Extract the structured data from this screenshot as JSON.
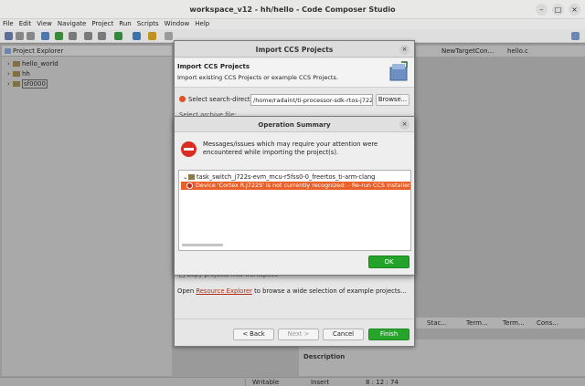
{
  "window": {
    "title": "workspace_v12 - hh/hello - Code Composer Studio"
  },
  "menu": [
    "File",
    "Edit",
    "View",
    "Navigate",
    "Project",
    "Run",
    "Scripts",
    "Window",
    "Help"
  ],
  "project_explorer": {
    "tab_label": "Project Explorer",
    "items": [
      {
        "label": "hello_world"
      },
      {
        "label": "hh"
      },
      {
        "label": "sf0000"
      }
    ]
  },
  "editor_tabs": [
    "NewTargetCon...",
    "hello.c"
  ],
  "lower_right_tabs": [
    "Stac...",
    "Term...",
    "Term...",
    "Cons..."
  ],
  "description_label": "Description",
  "status_bar": {
    "mode": "Writable",
    "insert": "Insert",
    "position": "8 : 12 : 74"
  },
  "import_dialog": {
    "title": "Import CCS Projects",
    "heading": "Import CCS Projects",
    "subheading": "Import existing CCS Projects or example CCS Projects.",
    "search_dir_label": "Select search-directory:",
    "search_dir_value": "/home/radaint/ti-processor-sdk-rtos-j722",
    "browse_label": "Browse...",
    "archive_label": "Select archive file:",
    "copy_label": "Copy projects into workspace",
    "open_prefix": "Open",
    "open_link": "Resource Explorer",
    "open_suffix": "to browse a wide selection of example projects...",
    "back_label": "< Back",
    "next_label": "Next >",
    "cancel_label": "Cancel",
    "finish_label": "Finish"
  },
  "operation_summary": {
    "title": "Operation Summary",
    "message": "Messages/issues which may require your attention were encountered while importing the project(s).",
    "project_node": "task_switch_j722s-evm_mcu-r5fss0-0_freertos_ti-arm-clang",
    "error_text": "Device 'Cortex R.J722S' is not currently recognized: - Re-run CCS installer on your",
    "ok_label": "OK"
  },
  "colors": {
    "accent_green": "#23a32a",
    "error_orange": "#e8602a",
    "error_red": "#d92c22"
  }
}
